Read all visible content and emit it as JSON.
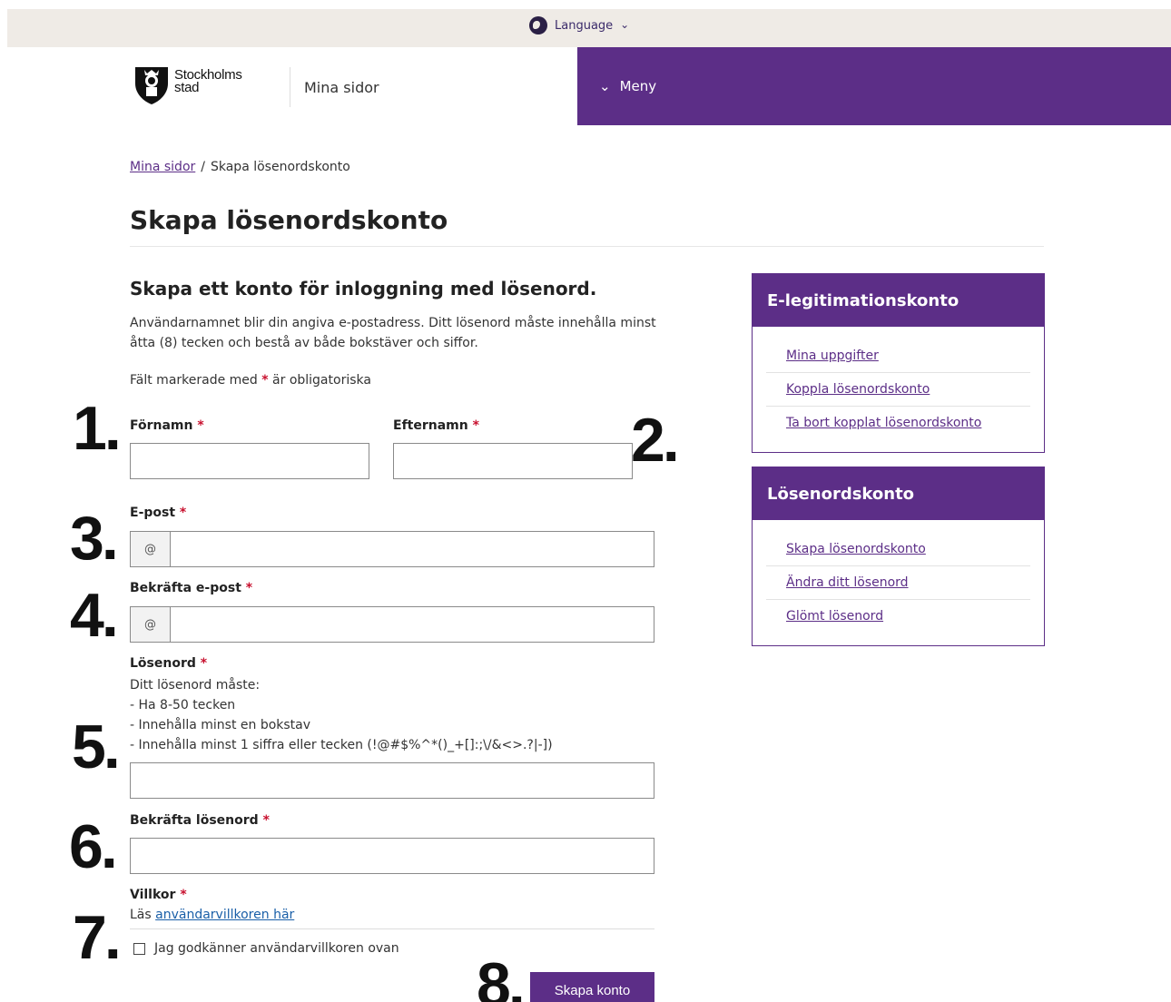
{
  "topbar": {
    "language_label": "Language",
    "globe_icon": "globe-icon",
    "chevron_icon": "chevron-down-icon"
  },
  "header": {
    "logo_line1": "Stockholms",
    "logo_line2": "stad",
    "site_title": "Mina sidor",
    "menu_label": "Meny"
  },
  "breadcrumb": {
    "home": "Mina sidor",
    "separator": "/",
    "current": "Skapa lösenordskonto"
  },
  "page": {
    "title": "Skapa lösenordskonto",
    "intro_title": "Skapa ett konto för inloggning med lösenord.",
    "intro_text": "Användarnamnet blir din angiva e-postadress. Ditt lösenord måste innehålla minst åtta (8) tecken och bestå av både bokstäver och siffor.",
    "required_prefix": "Fält markerade med",
    "required_star": "*",
    "required_suffix": "är obligatoriska"
  },
  "form": {
    "firstname_label": "Förnamn",
    "lastname_label": "Efternamn",
    "email_label": "E-post",
    "email_confirm_label": "Bekräfta e-post",
    "email_addon": "@",
    "password_label": "Lösenord",
    "password_help": [
      "Ditt lösenord måste:",
      "- Ha 8-50 tecken",
      "- Innehålla minst en bokstav",
      "- Innehålla minst 1 siffra eller tecken (!@#$%^*()_+[]:;\\/&<>.?|-])"
    ],
    "password_confirm_label": "Bekräfta lösenord",
    "terms_label": "Villkor",
    "terms_read_prefix": "Läs",
    "terms_link": "användarvillkoren här",
    "terms_checkbox": "Jag godkänner användarvillkoren ovan",
    "submit_label": "Skapa konto",
    "star": "*"
  },
  "annotations": [
    "1.",
    "2.",
    "3.",
    "4.",
    "5.",
    "6.",
    "7.",
    "8."
  ],
  "sidebar": {
    "eid": {
      "title": "E-legitimationskonto",
      "items": [
        "Mina uppgifter",
        "Koppla lösenordskonto",
        "Ta bort kopplat lösenordskonto"
      ]
    },
    "password": {
      "title": "Lösenordskonto",
      "items": [
        "Skapa lösenordskonto",
        "Ändra ditt lösenord",
        "Glömt lösenord"
      ]
    }
  },
  "colors": {
    "brand_purple": "#5c2e87",
    "topbar_bg": "#efebe6",
    "required_red": "#c8102e",
    "link_blue": "#1a5fa8"
  }
}
